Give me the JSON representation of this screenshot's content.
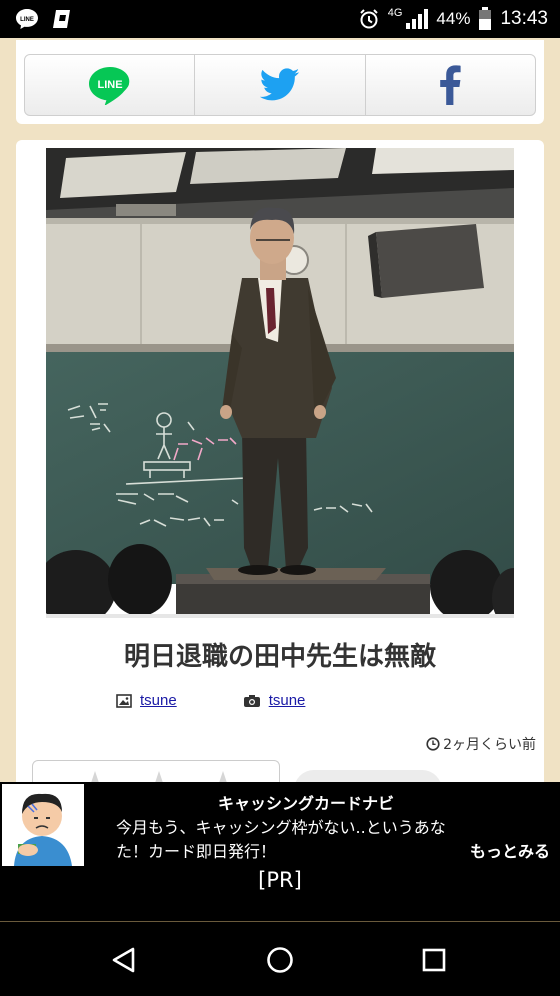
{
  "status_bar": {
    "network": "4G",
    "battery": "44%",
    "time": "13:43",
    "icons": [
      "line-notification-icon",
      "app-notification-icon",
      "alarm-icon",
      "signal-icon",
      "battery-icon"
    ]
  },
  "share": {
    "line_label": "LINE",
    "buttons": [
      "line-share",
      "twitter-share",
      "facebook-share"
    ]
  },
  "article": {
    "title": "明日退職の田中先生は無敵",
    "image_credit": "tsune",
    "photo_credit": "tsune",
    "timestamp": "2ヶ月くらい前"
  },
  "ad": {
    "title": "キャッシングカードナビ",
    "body": "今月もう、キャッシング枠がない..というあなた！カード即日発行！",
    "more": "もっとみる",
    "pr": "[PR]"
  },
  "colors": {
    "page_bg": "#f0e2c4",
    "line_green": "#06c755",
    "twitter_blue": "#1da1f2",
    "facebook_blue": "#3b5998",
    "link": "#1a1aa6"
  }
}
